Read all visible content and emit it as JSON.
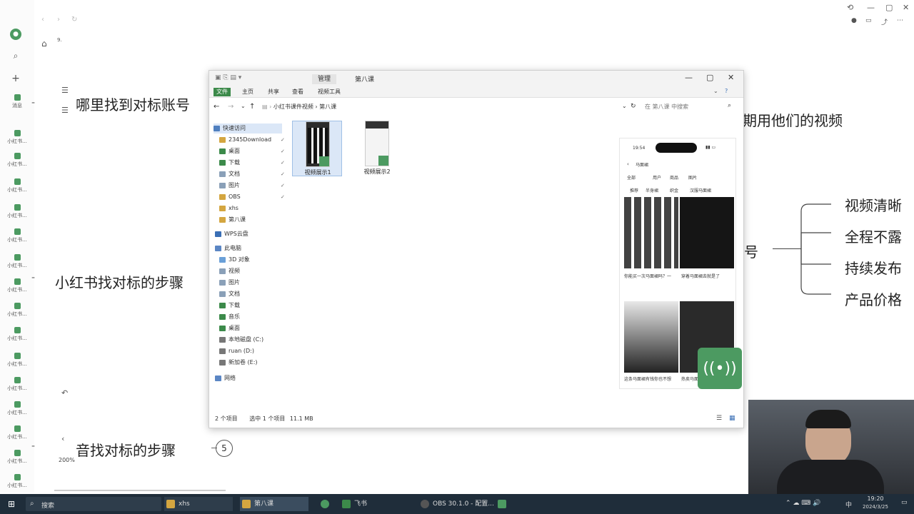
{
  "app": {
    "breadcrumb_num": "9.",
    "zoom": "200%",
    "rail_items": [
      "小红书...",
      "小红书...",
      "小红书...",
      "小红书...",
      "小红书...",
      "小红书...",
      "小红书...",
      "小红书...",
      "小红书...",
      "小红书...",
      "小红书...",
      "小红书...",
      "小红书...",
      "小红书...",
      "小红书...",
      "小红书..."
    ],
    "rail_top_label": "消息"
  },
  "mindmap": {
    "node_find_account": "哪里找到对标账号",
    "node_xhs_steps": "小红书找对标的步骤",
    "node_steps_bottom": "音找对标的步骤",
    "node_steps_badge": "5",
    "node_use_videos": "期用他们的视频",
    "node_hao": "号",
    "branches": [
      "视频清晰",
      "全程不露",
      "持续发布",
      "产品价格"
    ]
  },
  "explorer": {
    "title": "第八课",
    "title_tab": "管理",
    "ribbon": [
      "文件",
      "主页",
      "共享",
      "查看",
      "视频工具"
    ],
    "path": [
      "小红书课件视频",
      "第八课"
    ],
    "search_placeholder": "在 第八课 中搜索",
    "nav": {
      "quick_access": "快速访问",
      "items": [
        "2345Download",
        "桌面",
        "下载",
        "文档",
        "图片",
        "OBS",
        "xhs",
        "第八课"
      ],
      "wps": "WPS云盘",
      "this_pc": "此电脑",
      "pc_items": [
        "3D 对象",
        "视频",
        "图片",
        "文档",
        "下载",
        "音乐",
        "桌面",
        "本地磁盘 (C:)",
        "ruan (D:)",
        "新加卷 (E:)"
      ],
      "network": "网络"
    },
    "files": [
      "视频展示1",
      "视频展示2"
    ],
    "status": {
      "count": "2 个项目",
      "selected": "选中 1 个项目",
      "size": "11.1 MB"
    }
  },
  "phone": {
    "time": "19:54",
    "search": "马面裙",
    "tabs": [
      "全部",
      "用户",
      "商品",
      "图片"
    ],
    "filters": [
      "推荐",
      "半身裙",
      "织金",
      "汉服马面裙"
    ],
    "card1": "你能买一次马面裙吗？一",
    "card2": "穿着马面裙去就是了",
    "card3": "这条马面裙有钱你也不想",
    "card4": "热卖马面裙"
  },
  "taskbar": {
    "search": "搜索",
    "items": [
      "xhs",
      "第八课",
      "飞书",
      "OBS 30.1.0 - 配置...",
      ""
    ],
    "time": "19:20",
    "date": "2024/3/25",
    "ime": "中"
  },
  "colors": {
    "accent_green": "#4c9a61",
    "taskbar": "#1f2d3a",
    "ribbon_file": "#3c8a4a"
  }
}
